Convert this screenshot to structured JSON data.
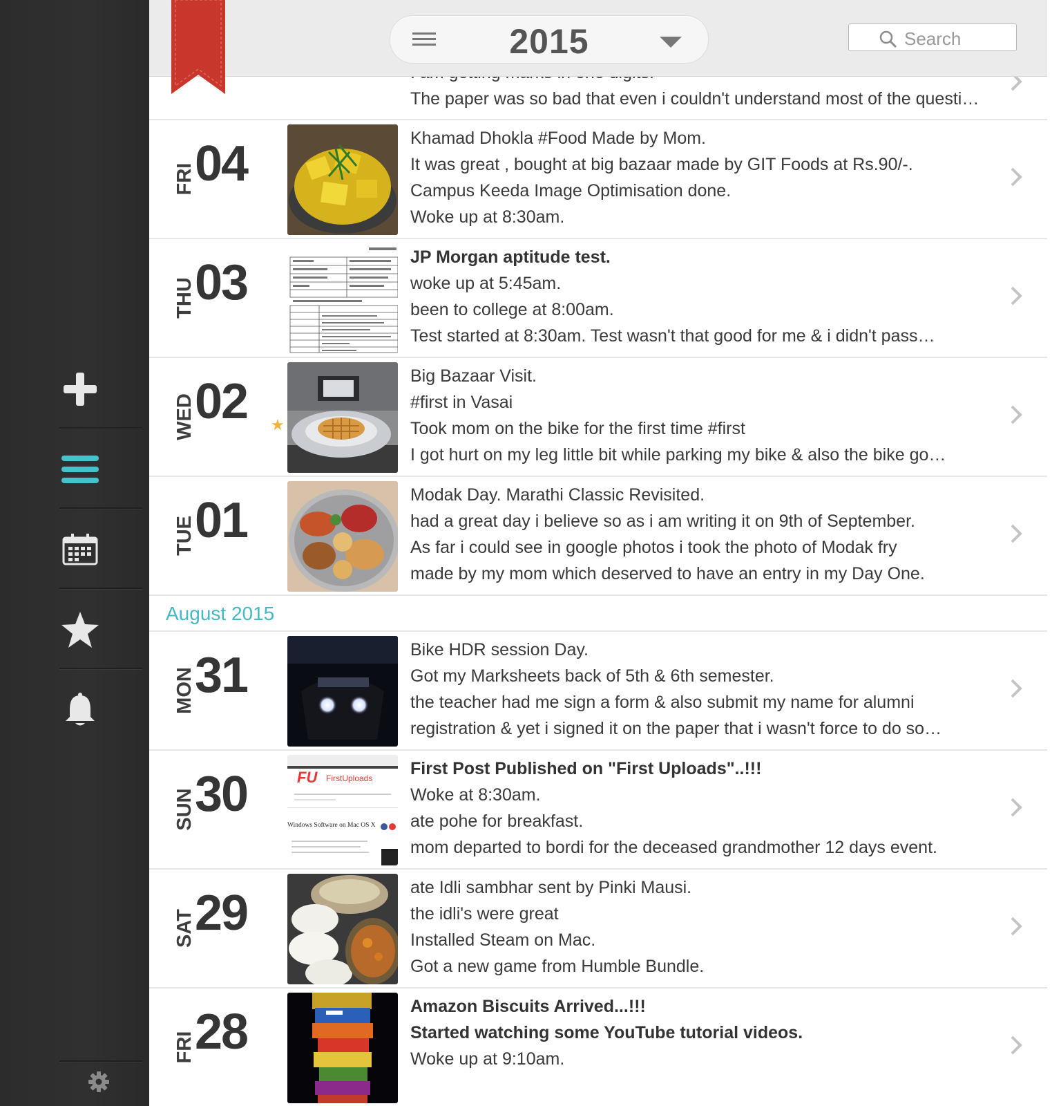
{
  "header": {
    "year": "2015",
    "search_placeholder": "Search",
    "menu_icon": "hamburger-icon",
    "dropdown_icon": "caret-down-icon"
  },
  "sidebar": {
    "items": [
      {
        "name": "add-entry",
        "icon": "plus-icon"
      },
      {
        "name": "timeline",
        "icon": "list-icon",
        "active": true
      },
      {
        "name": "calendar",
        "icon": "calendar-icon"
      },
      {
        "name": "starred",
        "icon": "star-icon"
      },
      {
        "name": "reminders",
        "icon": "bell-icon"
      }
    ],
    "settings_icon": "gear-icon",
    "active_color": "#45c3cc"
  },
  "partial_entry": {
    "lines": [
      "I am getting marks in one digits.",
      "The paper was so bad that even i couldn't understand most of the questions."
    ]
  },
  "entries_sep": [
    {
      "day": "FRI",
      "num": "04",
      "thumb": "dhokla-photo",
      "lines": [
        {
          "t": "Khamad Dhokla #Food Made by Mom.",
          "b": false
        },
        {
          "t": "It was great , bought at big bazaar made by GIT Foods at Rs.90/-.",
          "b": false
        },
        {
          "t": "Campus Keeda Image Optimisation done.",
          "b": false
        },
        {
          "t": "Woke up at 8:30am.",
          "b": false
        }
      ]
    },
    {
      "day": "THU",
      "num": "03",
      "thumb": "document-photo",
      "lines": [
        {
          "t": "JP Morgan aptitude test.",
          "b": true
        },
        {
          "t": "woke up at 5:45am.",
          "b": false
        },
        {
          "t": "been to college at 8:00am.",
          "b": false
        },
        {
          "t": "Test started at 8:30am. Test wasn't that good for me & i didn't pass…",
          "b": false
        }
      ]
    },
    {
      "day": "WED",
      "num": "02",
      "thumb": "waffle-photo",
      "starred": true,
      "lines": [
        {
          "t": "Big Bazaar Visit.",
          "b": false
        },
        {
          "t": "#first in Vasai",
          "b": false
        },
        {
          "t": "Took mom on the bike for the first time #first",
          "b": false
        },
        {
          "t": "I got hurt on my leg little bit while parking my bike & also the bike go…",
          "b": false
        }
      ]
    },
    {
      "day": "TUE",
      "num": "01",
      "thumb": "thali-photo",
      "lines": [
        {
          "t": "Modak Day. Marathi Classic Revisited.",
          "b": false
        },
        {
          "t": "had a great day i believe so as i am writing it on 9th of September.",
          "b": false
        },
        {
          "t": "As far i could see in google photos i took the photo of Modak fry",
          "b": false
        },
        {
          "t": "made by my mom which deserved to have an entry in my Day One.",
          "b": false
        }
      ]
    }
  ],
  "month_label": "August 2015",
  "entries_aug": [
    {
      "day": "MON",
      "num": "31",
      "thumb": "bike-photo",
      "lines": [
        {
          "t": "Bike HDR session Day.",
          "b": false
        },
        {
          "t": "Got my Marksheets back of 5th & 6th semester.",
          "b": false
        },
        {
          "t": "the teacher had me sign a form & also submit my name for alumni",
          "b": false
        },
        {
          "t": "registration & yet i signed it on the paper that i wasn't force to do so…",
          "b": false
        }
      ]
    },
    {
      "day": "SUN",
      "num": "30",
      "thumb": "website-screenshot",
      "thumb_text": {
        "logo": "FirstUploads",
        "headline": "Windows Software on Mac OS X"
      },
      "lines": [
        {
          "t": "First Post Published on \"First Uploads\"..!!!",
          "b": true
        },
        {
          "t": "Woke at 8:30am.",
          "b": false
        },
        {
          "t": " ate pohe for breakfast.",
          "b": false
        },
        {
          "t": "mom departed to bordi for the deceased grandmother 12 days event.",
          "b": false
        }
      ]
    },
    {
      "day": "SAT",
      "num": "29",
      "thumb": "idli-photo",
      "lines": [
        {
          "t": "ate Idli sambhar sent by Pinki Mausi.",
          "b": false
        },
        {
          "t": "the idli's were great",
          "b": false
        },
        {
          "t": "Installed Steam on Mac.",
          "b": false
        },
        {
          "t": "Got a new game from Humble Bundle.",
          "b": false
        }
      ]
    },
    {
      "day": "FRI",
      "num": "28",
      "thumb": "biscuits-photo",
      "lines": [
        {
          "t": "Amazon Biscuits Arrived...!!!",
          "b": true
        },
        {
          "t": "Started watching some YouTube tutorial videos.",
          "b": true
        },
        {
          "t": "Woke up at 9:10am.",
          "b": false
        }
      ]
    }
  ]
}
